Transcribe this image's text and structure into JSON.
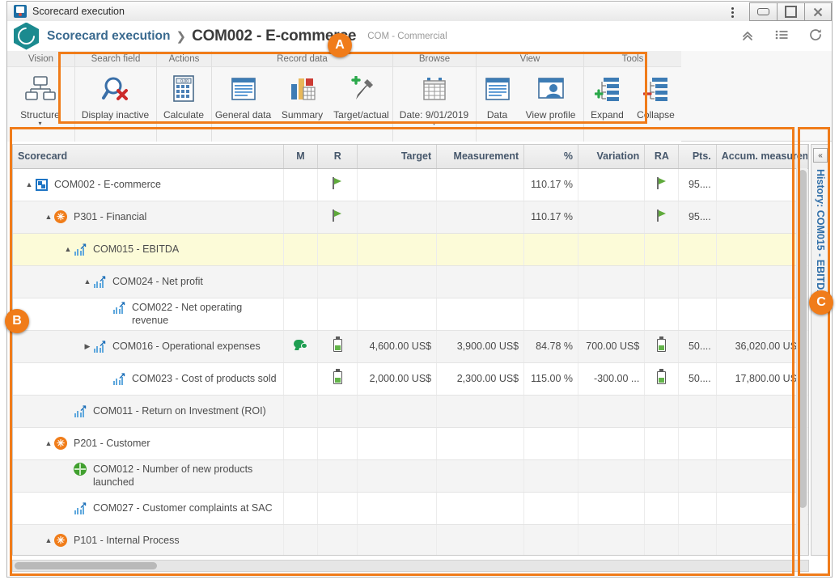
{
  "window": {
    "title": "Scorecard execution",
    "icon": "app-icon",
    "controls": {
      "menu": "⋮",
      "minimize": "minimize",
      "maximize": "maximize",
      "close": "✕"
    }
  },
  "header": {
    "breadcrumb_root": "Scorecard execution",
    "separator": "❯",
    "current": "COM002 - E-commerce",
    "subtitle": "COM - Commercial",
    "tools": [
      {
        "name": "collapse-all-icon",
        "label": "collapse"
      },
      {
        "name": "list-view-icon",
        "label": "list"
      },
      {
        "name": "refresh-icon",
        "label": "refresh"
      }
    ]
  },
  "ribbon": {
    "groups": [
      {
        "title": "Vision",
        "buttons": [
          {
            "label": "Structure",
            "icon": "structure-icon",
            "caret": "▾"
          }
        ]
      },
      {
        "title": "Search field",
        "buttons": [
          {
            "label": "Display inactive",
            "icon": "search-inactive-icon",
            "caret": ""
          }
        ]
      },
      {
        "title": "Actions",
        "buttons": [
          {
            "label": "Calculate",
            "icon": "calculator-icon",
            "caret": ""
          }
        ]
      },
      {
        "title": "Record data",
        "buttons": [
          {
            "label": "General data",
            "icon": "general-data-icon",
            "caret": ""
          },
          {
            "label": "Summary",
            "icon": "summary-chart-icon",
            "caret": ""
          },
          {
            "label": "Target/actual",
            "icon": "target-actual-pen-icon",
            "caret": ""
          }
        ]
      },
      {
        "title": "Browse",
        "buttons": [
          {
            "label": "Date: 9/01/2019",
            "icon": "calendar-icon",
            "caret": "▾"
          }
        ]
      },
      {
        "title": "View",
        "buttons": [
          {
            "label": "Data",
            "icon": "data-icon",
            "caret": ""
          },
          {
            "label": "View profile",
            "icon": "view-profile-icon",
            "caret": ""
          }
        ]
      },
      {
        "title": "Tools",
        "buttons": [
          {
            "label": "Expand",
            "icon": "expand-tree-icon",
            "caret": ""
          },
          {
            "label": "Collapse",
            "icon": "collapse-tree-icon",
            "caret": ""
          }
        ]
      }
    ]
  },
  "table": {
    "columns": [
      {
        "key": "scorecard",
        "label": "Scorecard",
        "align": "left"
      },
      {
        "key": "m",
        "label": "M",
        "align": "center"
      },
      {
        "key": "r",
        "label": "R",
        "align": "center"
      },
      {
        "key": "target",
        "label": "Target",
        "align": "right"
      },
      {
        "key": "measurement",
        "label": "Measurement",
        "align": "right"
      },
      {
        "key": "pct",
        "label": "%",
        "align": "right"
      },
      {
        "key": "variation",
        "label": "Variation",
        "align": "right"
      },
      {
        "key": "ra",
        "label": "RA",
        "align": "center"
      },
      {
        "key": "pts",
        "label": "Pts.",
        "align": "right"
      },
      {
        "key": "accum",
        "label": "Accum. measurem",
        "align": "right"
      }
    ],
    "rows": [
      {
        "indent": 0,
        "twisty": "▲",
        "icon": "perspective-icon",
        "name": "COM002 - E-commerce",
        "m": "",
        "r": "flag-green",
        "target": "",
        "measurement": "",
        "pct": "110.17 %",
        "variation": "",
        "ra": "flag-green",
        "pts": "95....",
        "accum": "",
        "style": "normal"
      },
      {
        "indent": 1,
        "twisty": "▲",
        "icon": "star-orange-icon",
        "name": "P301 - Financial",
        "m": "",
        "r": "flag-green",
        "target": "",
        "measurement": "",
        "pct": "110.17 %",
        "variation": "",
        "ra": "flag-green",
        "pts": "95....",
        "accum": "",
        "style": "alt"
      },
      {
        "indent": 2,
        "twisty": "▲",
        "icon": "kpi-chart-icon",
        "name": "COM015 - EBITDA",
        "m": "",
        "r": "",
        "target": "",
        "measurement": "",
        "pct": "",
        "variation": "",
        "ra": "",
        "pts": "",
        "accum": "",
        "style": "highlight"
      },
      {
        "indent": 3,
        "twisty": "▲",
        "icon": "kpi-chart-icon",
        "name": "COM024 - Net profit",
        "m": "",
        "r": "",
        "target": "",
        "measurement": "",
        "pct": "",
        "variation": "",
        "ra": "",
        "pts": "",
        "accum": "",
        "style": "alt"
      },
      {
        "indent": 4,
        "twisty": "",
        "icon": "kpi-chart-icon",
        "name": "COM022 - Net operating revenue",
        "m": "",
        "r": "",
        "target": "",
        "measurement": "",
        "pct": "",
        "variation": "",
        "ra": "",
        "pts": "",
        "accum": "",
        "style": "normal"
      },
      {
        "indent": 3,
        "twisty": "▶",
        "icon": "kpi-chart-icon",
        "name": "COM016 - Operational expenses",
        "m": "chat-green",
        "r": "battery-green",
        "target": "4,600.00 US$",
        "measurement": "3,900.00 US$",
        "pct": "84.78 %",
        "variation": "700.00 US$",
        "ra": "battery-green",
        "pts": "50....",
        "accum": "36,020.00 US$",
        "style": "alt"
      },
      {
        "indent": 4,
        "twisty": "",
        "icon": "kpi-chart-icon",
        "name": "COM023 - Cost of products sold",
        "m": "",
        "r": "battery-green",
        "target": "2,000.00 US$",
        "measurement": "2,300.00 US$",
        "pct": "115.00 %",
        "variation": "-300.00 ...",
        "ra": "battery-green",
        "pts": "50....",
        "accum": "17,800.00 US$",
        "style": "normal"
      },
      {
        "indent": 2,
        "twisty": "",
        "icon": "kpi-chart-icon",
        "name": "COM011 - Return on Investment (ROI)",
        "m": "",
        "r": "",
        "target": "",
        "measurement": "",
        "pct": "",
        "variation": "",
        "ra": "",
        "pts": "",
        "accum": "",
        "style": "alt"
      },
      {
        "indent": 1,
        "twisty": "▲",
        "icon": "star-orange-icon",
        "name": "P201 - Customer",
        "m": "",
        "r": "",
        "target": "",
        "measurement": "",
        "pct": "",
        "variation": "",
        "ra": "",
        "pts": "",
        "accum": "",
        "style": "normal"
      },
      {
        "indent": 2,
        "twisty": "",
        "icon": "globe-green-icon",
        "name": "COM012 - Number of new products launched",
        "m": "",
        "r": "",
        "target": "",
        "measurement": "",
        "pct": "",
        "variation": "",
        "ra": "",
        "pts": "",
        "accum": "",
        "style": "alt"
      },
      {
        "indent": 2,
        "twisty": "",
        "icon": "kpi-chart-icon",
        "name": "COM027 - Customer complaints at SAC",
        "m": "",
        "r": "",
        "target": "",
        "measurement": "",
        "pct": "",
        "variation": "",
        "ra": "",
        "pts": "",
        "accum": "",
        "style": "normal"
      },
      {
        "indent": 1,
        "twisty": "▲",
        "icon": "star-orange-icon",
        "name": "P101 - Internal Process",
        "m": "",
        "r": "",
        "target": "",
        "measurement": "",
        "pct": "",
        "variation": "",
        "ra": "",
        "pts": "",
        "accum": "",
        "style": "alt"
      }
    ]
  },
  "history_panel": {
    "collapse_label": "«",
    "title": "History: COM015 - EBITDA"
  },
  "annotations": [
    {
      "label": "A"
    },
    {
      "label": "B"
    },
    {
      "label": "C"
    }
  ],
  "colors": {
    "accent_orange": "#f07c1a",
    "link_blue": "#3a6a8f",
    "highlight_yellow": "#fcfbd8",
    "green": "#5faa3b"
  }
}
